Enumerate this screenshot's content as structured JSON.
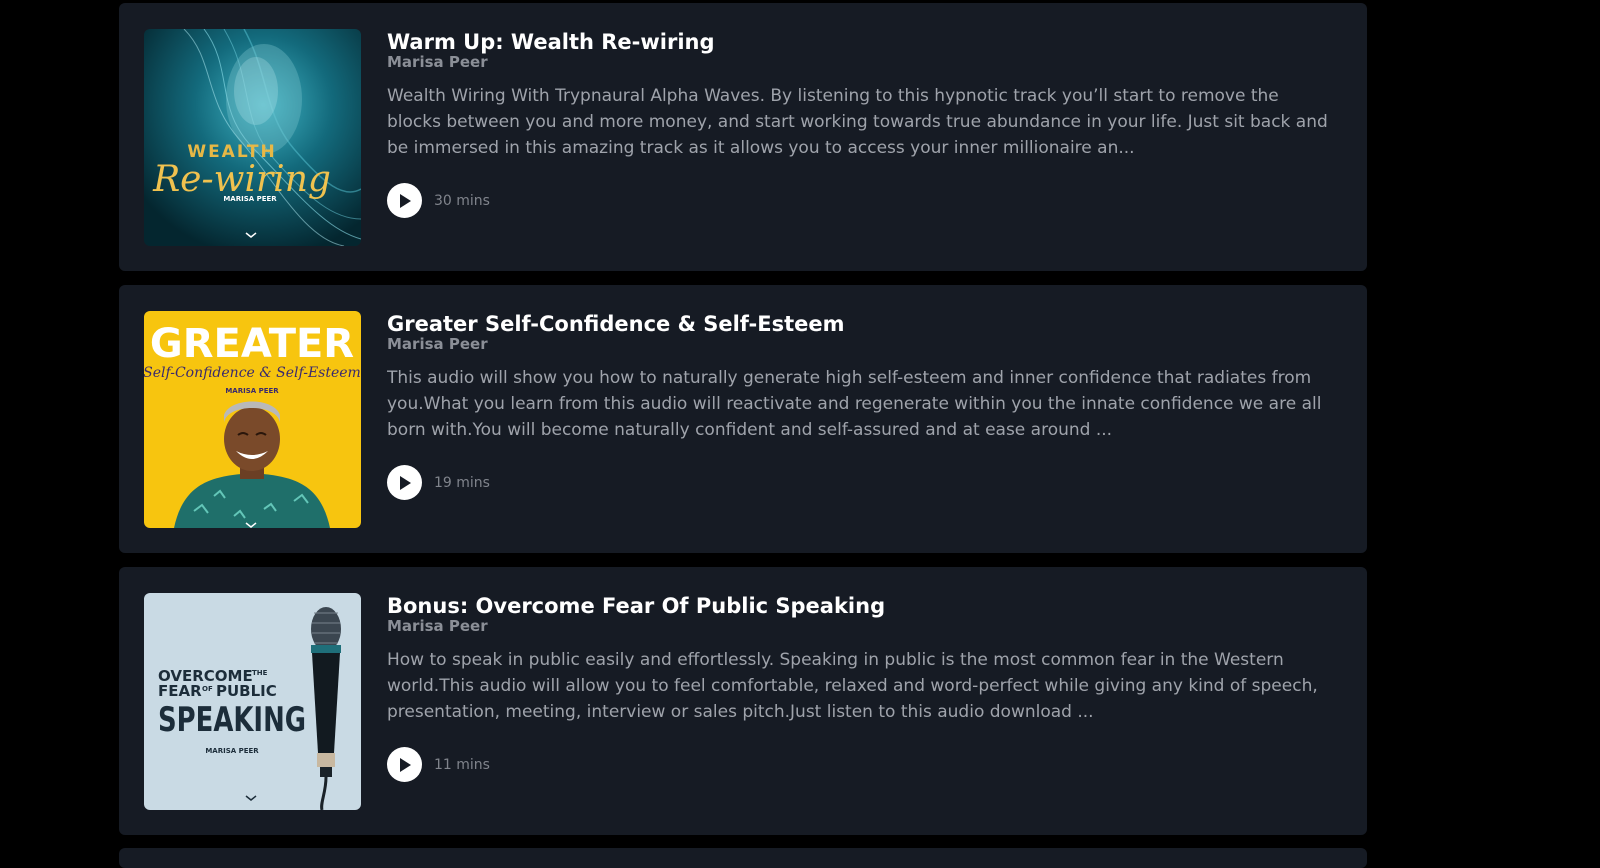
{
  "colors": {
    "page_background": "#000000",
    "card_background": "#161b24",
    "title": "#ffffff",
    "author": "#8b8f97",
    "description": "#9fa3ab",
    "duration": "#80848c"
  },
  "tracks": [
    {
      "title": "Warm Up: Wealth Re-wiring",
      "author": "Marisa Peer",
      "description": "Wealth Wiring With Trypnaural Alpha Waves. By listening to this hypnotic track you’ll start to remove the blocks between you and more money, and start working towards true abundance in your life. Just sit back and be immersed in this amazing track as it allows you to access your inner millionaire an...",
      "duration": "30 mins",
      "cover": {
        "line1": "WEALTH",
        "line2": "Re-wiring",
        "author": "MARISA PEER",
        "icon": "wealth-cover-art"
      }
    },
    {
      "title": "Greater Self-Confidence & Self-Esteem",
      "author": "Marisa Peer",
      "description": "This audio will show you how to naturally generate high self-esteem and inner confidence that radiates from you.What you learn from this audio will reactivate and regenerate within you the innate confidence we are all born with.You will become naturally confident and self-assured and at ease around ...",
      "duration": "19 mins",
      "cover": {
        "line1": "GREATER",
        "line2": "Self-Confidence & Self-Esteem",
        "author": "MARISA PEER",
        "icon": "smiling-man-cover-art"
      }
    },
    {
      "title": "Bonus: Overcome Fear Of Public Speaking",
      "author": "Marisa Peer",
      "description": "How to speak in public easily and effortlessly. Speaking in public is the most common fear in the Western world.This audio will allow you to feel comfortable, relaxed and word-perfect while giving any kind of speech, presentation, meeting, interview or sales pitch.Just listen to this audio download ...",
      "duration": "11 mins",
      "cover": {
        "line1a": "OVERCOME",
        "line1b": "THE",
        "line2a": "FEAR",
        "line2b": "OF",
        "line2c": "PUBLIC",
        "line3": "SPEAKING",
        "author": "MARISA PEER",
        "icon": "microphone-cover-art"
      }
    }
  ]
}
